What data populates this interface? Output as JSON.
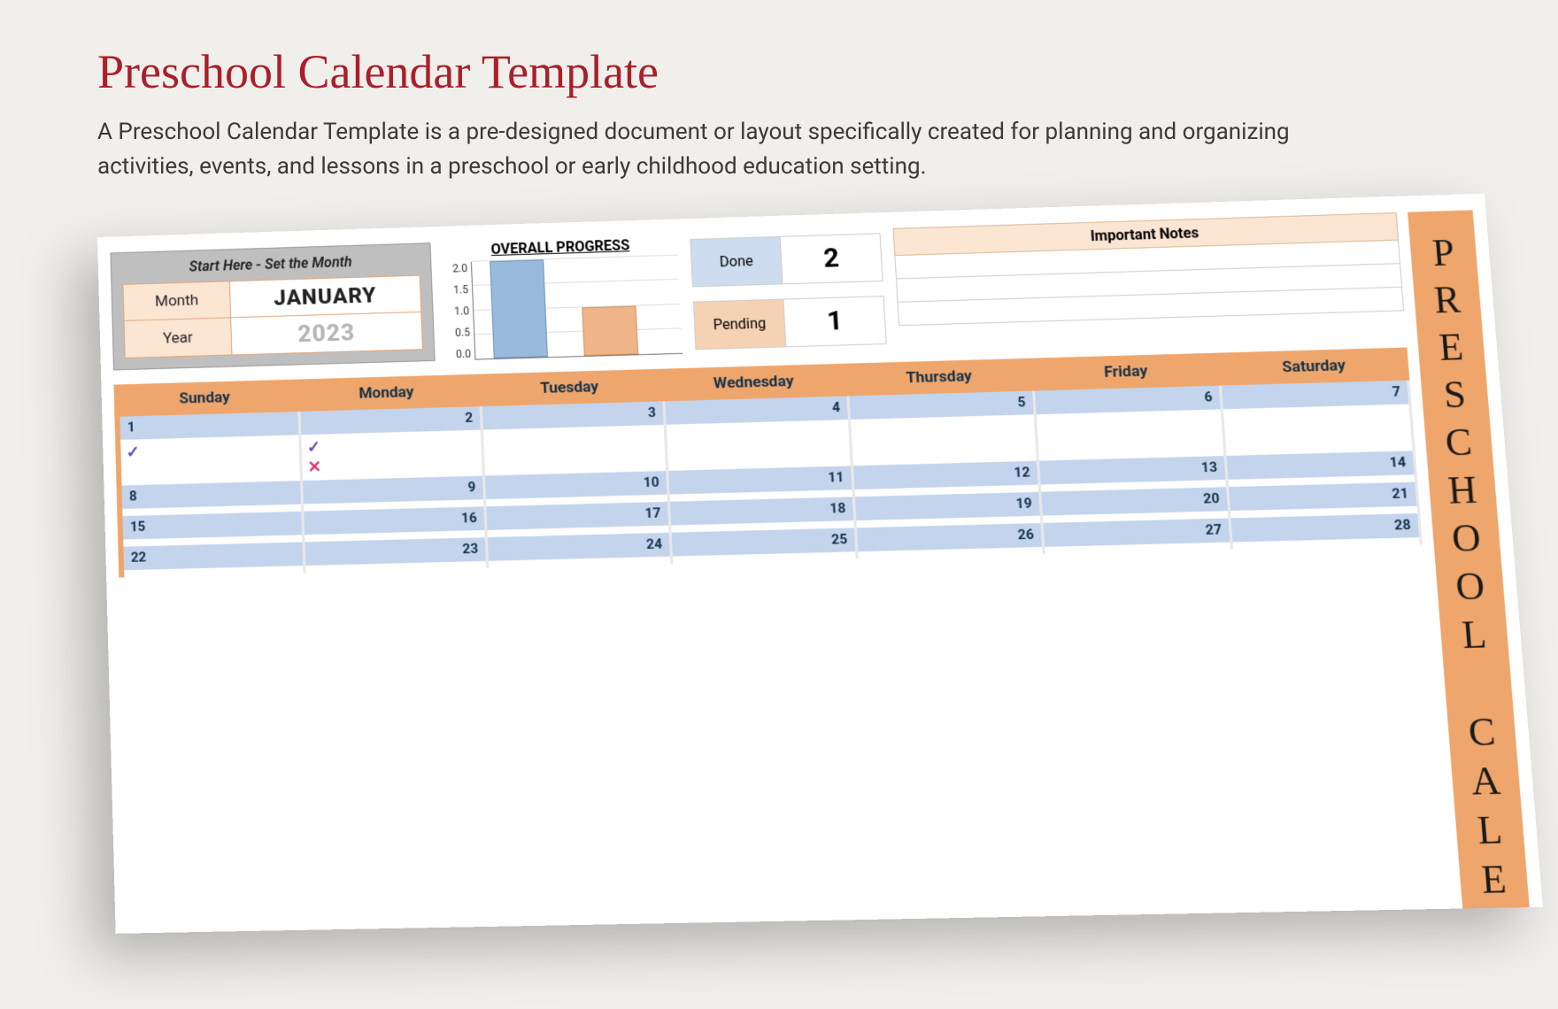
{
  "header": {
    "title": "Preschool Calendar Template",
    "description": "A Preschool Calendar Template is a pre-designed document or layout specifically created for planning and organizing activities, events, and lessons in a preschool or early childhood education setting."
  },
  "sidebar": {
    "vertical_title": "PRESCHOOL CALE"
  },
  "month_selector": {
    "hint": "Start Here - Set the Month",
    "month_label": "Month",
    "month_value": "JANUARY",
    "year_label": "Year",
    "year_value": "2023"
  },
  "chart_data": {
    "type": "bar",
    "title": "OVERALL PROGRESS",
    "categories": [
      "Done",
      "Pending"
    ],
    "values": [
      2,
      1
    ],
    "ylim": [
      0,
      2
    ],
    "yticks": [
      "2.0",
      "1.5",
      "1.0",
      "0.5",
      "0.0"
    ]
  },
  "status": {
    "done_label": "Done",
    "done_value": "2",
    "pending_label": "Pending",
    "pending_value": "1"
  },
  "notes": {
    "header": "Important Notes",
    "lines": [
      "",
      "",
      ""
    ]
  },
  "calendar": {
    "weekdays": [
      "Sunday",
      "Monday",
      "Tuesday",
      "Wednesday",
      "Thursday",
      "Friday",
      "Saturday"
    ],
    "weeks": [
      {
        "days": [
          {
            "num": "1",
            "marks": [
              "check"
            ]
          },
          {
            "num": "2",
            "marks": [
              "check",
              "cross"
            ]
          },
          {
            "num": "3",
            "marks": []
          },
          {
            "num": "4",
            "marks": []
          },
          {
            "num": "5",
            "marks": []
          },
          {
            "num": "6",
            "marks": []
          },
          {
            "num": "7",
            "marks": []
          }
        ]
      },
      {
        "days": [
          {
            "num": "8"
          },
          {
            "num": "9"
          },
          {
            "num": "10"
          },
          {
            "num": "11"
          },
          {
            "num": "12"
          },
          {
            "num": "13"
          },
          {
            "num": "14"
          }
        ]
      },
      {
        "days": [
          {
            "num": "15"
          },
          {
            "num": "16"
          },
          {
            "num": "17"
          },
          {
            "num": "18"
          },
          {
            "num": "19"
          },
          {
            "num": "20"
          },
          {
            "num": "21"
          }
        ]
      },
      {
        "days": [
          {
            "num": "22"
          },
          {
            "num": "23"
          },
          {
            "num": "24"
          },
          {
            "num": "25"
          },
          {
            "num": "26"
          },
          {
            "num": "27"
          },
          {
            "num": "28"
          }
        ]
      }
    ]
  },
  "icons": {
    "check": "✓",
    "cross": "✕"
  }
}
